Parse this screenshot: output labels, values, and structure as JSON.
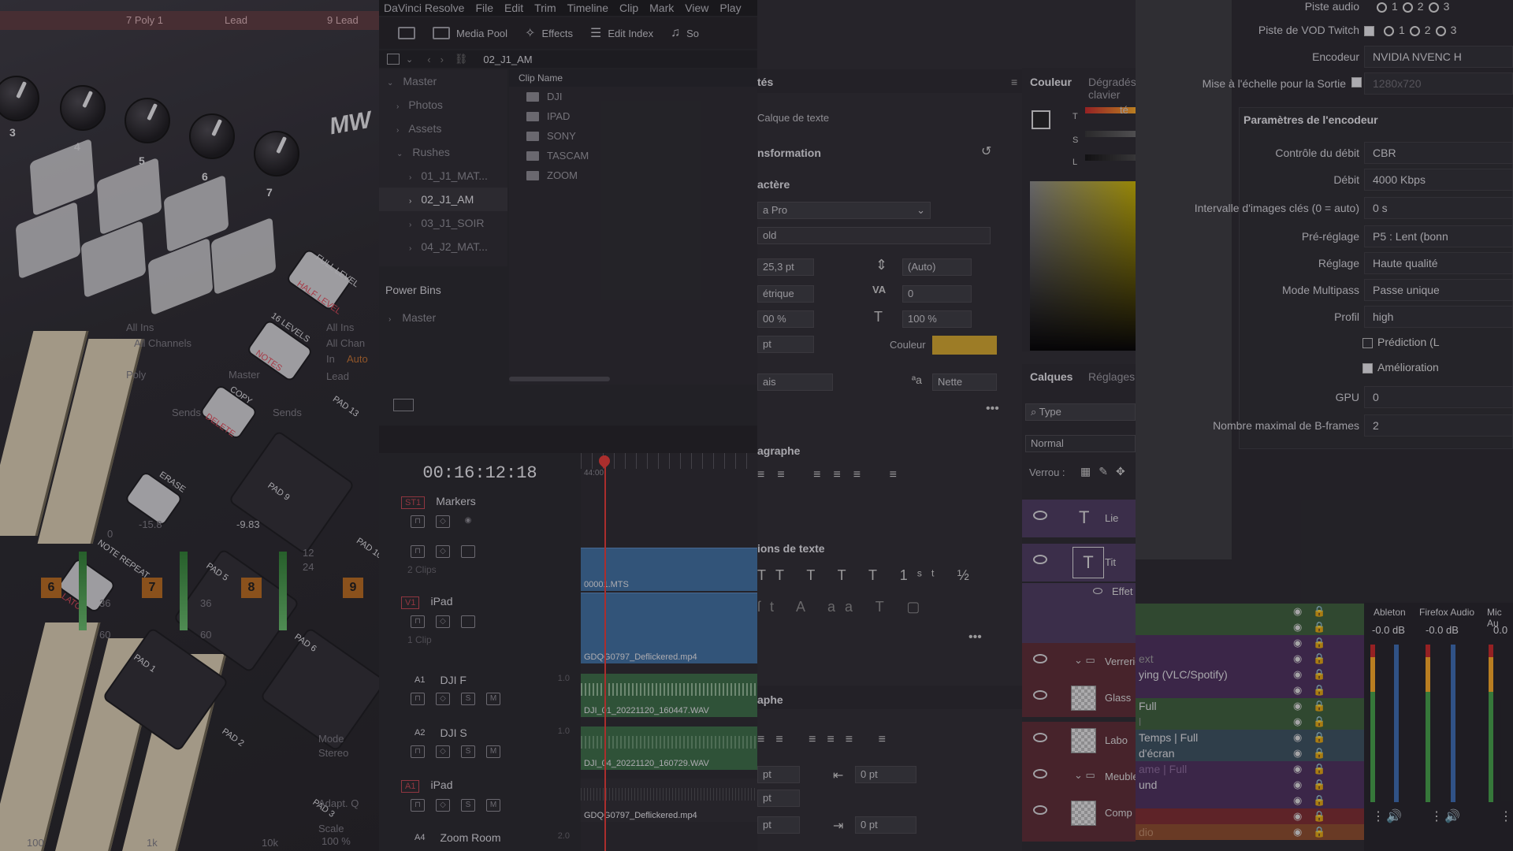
{
  "controller": {
    "knobs": [
      "3",
      "4",
      "5",
      "6",
      "7"
    ],
    "brand": "MW",
    "buttons": [
      {
        "main": "FULL LEVEL",
        "sub": "HALF LEVEL"
      },
      {
        "main": "16 LEVELS",
        "sub": "NOTES"
      },
      {
        "main": "COPY",
        "sub": "DELETE"
      },
      {
        "main": "ERASE",
        "sub": ""
      },
      {
        "main": "NOTE REPEAT",
        "sub": "LATCH"
      }
    ],
    "pads": [
      "PAD 1",
      "PAD 2",
      "PAD 3",
      "PAD 5",
      "PAD 6",
      "PAD 9",
      "PAD 10",
      "PAD 13"
    ],
    "ghost": [
      "All Ins",
      "All Channels",
      "Master",
      "Sends",
      "Sends",
      "Lead",
      "All Ins",
      "All Chan",
      "In",
      "Auto",
      "Poly",
      "Mode",
      "Stereo",
      "Adapt. Q",
      "Scale",
      "100 %",
      "100",
      "1k",
      "10k",
      "-9.83",
      "12",
      "24",
      "36",
      "60",
      "-15.8",
      "0",
      "36",
      "60"
    ],
    "track_numbers": [
      "6",
      "7",
      "8",
      "9"
    ],
    "top_labels": [
      "7 Poly 1",
      "Lead",
      "9 Lead"
    ]
  },
  "resolve": {
    "menu": [
      "DaVinci Resolve",
      "File",
      "Edit",
      "Trim",
      "Timeline",
      "Clip",
      "Mark",
      "View",
      "Play"
    ],
    "toolbar": {
      "media_pool": "Media Pool",
      "effects": "Effects",
      "edit_index": "Edit Index",
      "sound": "So"
    },
    "current_bin": "02_J1_AM",
    "bins": [
      {
        "label": "Master",
        "level": 0
      },
      {
        "label": "Photos",
        "level": 1
      },
      {
        "label": "Assets",
        "level": 1
      },
      {
        "label": "Rushes",
        "level": 1
      },
      {
        "label": "01_J1_MAT...",
        "level": 2
      },
      {
        "label": "02_J1_AM",
        "level": 2,
        "selected": true
      },
      {
        "label": "03_J1_SOIR",
        "level": 2
      },
      {
        "label": "04_J2_MAT...",
        "level": 2
      }
    ],
    "power_bins_title": "Power Bins",
    "power_bins_master": "Master",
    "clip_header": "Clip Name",
    "clips": [
      "DJI",
      "IPAD",
      "SONY",
      "TASCAM",
      "ZOOM"
    ],
    "timecode": "00:16:12:18",
    "ruler_mark": "44:00",
    "tracks": [
      {
        "badge": "ST1",
        "name": "Markers"
      },
      {
        "badge": "",
        "name": "",
        "note": "2 Clips"
      },
      {
        "badge": "V1",
        "name": "iPad",
        "note": "1 Clip"
      },
      {
        "badge": "A1",
        "name": "DJI F",
        "level": "1.0"
      },
      {
        "badge": "A2",
        "name": "DJI S",
        "level": "1.0"
      },
      {
        "badge": "A1",
        "name": "iPad",
        "level": ""
      },
      {
        "badge": "A4",
        "name": "Zoom Room",
        "level": "2.0"
      }
    ],
    "timeline_clips": {
      "v2": "00001.MTS",
      "v1": "GDQG0797_Deflickered.mp4",
      "a1": "DJI_01_20221120_160447.WAV",
      "a2": "DJI_04_20221120_160729.WAV",
      "a3": "GDQG0797_Deflickered.mp4"
    }
  },
  "photoshop": {
    "properties_title": "tés",
    "layer_kind": "Calque de texte",
    "transform": "nsformation",
    "character": "actère",
    "font_family": "a Pro",
    "font_style": "old",
    "font_size": "25,3 pt",
    "leading": "(Auto)",
    "kerning": "étrique",
    "tracking": "0",
    "vscale": "00 %",
    "hscale": "100 %",
    "baseline": "pt",
    "color_label": "Couleur",
    "color_value": "#d2a62c",
    "language": "ais",
    "antialias": "Nette",
    "paragraph": "agraphe",
    "text_options": "ions de texte",
    "paragraph2": "aphe",
    "indent_values": [
      "pt",
      "pt",
      "pt"
    ],
    "space_values": [
      "0 pt",
      "0 pt"
    ],
    "color_tab": "Couleur",
    "gradients_tab": "Dégradés clavier",
    "color_suffix": "té",
    "hsl": [
      "T",
      "S",
      "L"
    ],
    "layers_tab": "Calques",
    "adjust_tab": "Réglages",
    "filter": "Type",
    "blend": "Normal",
    "lock": "Verrou :",
    "layers": [
      {
        "name": "Lie",
        "kind": "text"
      },
      {
        "name": "Tit",
        "kind": "text"
      },
      {
        "name": "Effet",
        "kind": "fx"
      },
      {
        "name": "Verrerie",
        "kind": "group"
      },
      {
        "name": "Glass",
        "kind": "image"
      },
      {
        "name": "Labo",
        "kind": "image"
      },
      {
        "name": "Meuble",
        "kind": "group"
      },
      {
        "name": "Comp",
        "kind": "image"
      }
    ]
  },
  "obs": {
    "rows": [
      {
        "label": "Piste audio",
        "value": "1  2  3",
        "type": "radio"
      },
      {
        "label": "Piste de VOD Twitch",
        "value": "1  2  3",
        "type": "check-radio"
      },
      {
        "label": "Encodeur",
        "value": "NVIDIA NVENC H"
      },
      {
        "label": "Mise à l'échelle pour la Sortie",
        "value": "1280x720",
        "type": "check"
      }
    ],
    "encoder_title": "Paramètres de l'encodeur",
    "settings": [
      {
        "label": "Contrôle du débit",
        "value": "CBR"
      },
      {
        "label": "Débit",
        "value": "4000 Kbps"
      },
      {
        "label": "Intervalle d'images clés (0 = auto)",
        "value": "0 s"
      },
      {
        "label": "Pré-réglage",
        "value": "P5 : Lent (bonn"
      },
      {
        "label": "Réglage",
        "value": "Haute qualité"
      },
      {
        "label": "Mode Multipass",
        "value": "Passe unique"
      },
      {
        "label": "Profil",
        "value": "high"
      }
    ],
    "checks": [
      "Prédiction (L",
      "Amélioration"
    ],
    "gpu_label": "GPU",
    "gpu_value": "0",
    "bframes_label": "Nombre maximal de B-frames",
    "bframes_value": "2",
    "sources": [
      "ext",
      "ying (VLC/Spotify)",
      "Full",
      "l",
      "Temps | Full",
      "d'écran",
      "ame | Full",
      "und",
      "",
      "dio"
    ],
    "mixer": [
      {
        "name": "Ableton",
        "db": "-0.0 dB"
      },
      {
        "name": "Firefox Audio",
        "db": "-0.0 dB"
      },
      {
        "name": "Mic Au",
        "db": "0.0"
      }
    ]
  }
}
